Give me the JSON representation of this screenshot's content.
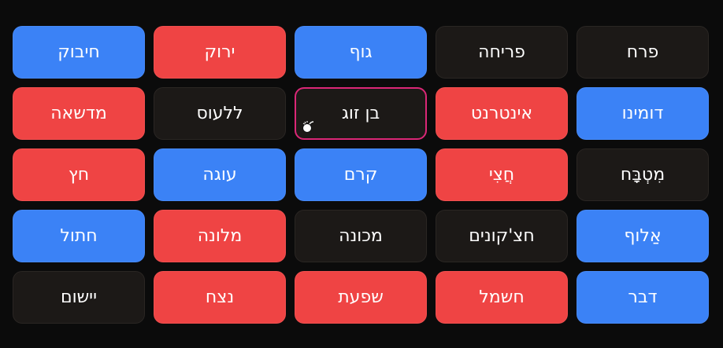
{
  "board": {
    "tiles": [
      {
        "word": "פרח",
        "color": "dark"
      },
      {
        "word": "פריחה",
        "color": "dark"
      },
      {
        "word": "גוף",
        "color": "blue"
      },
      {
        "word": "ירוק",
        "color": "red"
      },
      {
        "word": "חיבוק",
        "color": "blue"
      },
      {
        "word": "דומינו",
        "color": "blue"
      },
      {
        "word": "אינטרנט",
        "color": "red"
      },
      {
        "word": "בן זוג",
        "color": "dark",
        "selected": true,
        "icon": "bomb-icon"
      },
      {
        "word": "ללעוס",
        "color": "dark"
      },
      {
        "word": "מדשאה",
        "color": "red"
      },
      {
        "word": "מִטְבָּח",
        "color": "dark"
      },
      {
        "word": "חֲצִי",
        "color": "red"
      },
      {
        "word": "קרם",
        "color": "blue"
      },
      {
        "word": "עוגה",
        "color": "blue"
      },
      {
        "word": "חץ",
        "color": "red"
      },
      {
        "word": "אַלוף",
        "color": "blue"
      },
      {
        "word": "חצ'קונים",
        "color": "dark"
      },
      {
        "word": "מכונה",
        "color": "dark"
      },
      {
        "word": "מלונה",
        "color": "red"
      },
      {
        "word": "חתול",
        "color": "blue"
      },
      {
        "word": "דבר",
        "color": "blue"
      },
      {
        "word": "חשמל",
        "color": "red"
      },
      {
        "word": "שפעת",
        "color": "red"
      },
      {
        "word": "נצח",
        "color": "red"
      },
      {
        "word": "יישום",
        "color": "dark"
      }
    ]
  },
  "colors": {
    "blue": "#3b82f6",
    "red": "#ef4444",
    "dark": "#1c1917",
    "selected_border": "#db2777",
    "background": "#0b0b0b"
  }
}
